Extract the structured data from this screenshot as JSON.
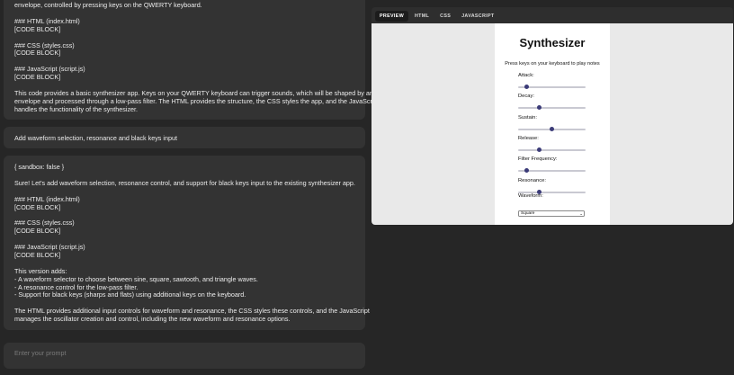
{
  "chat": {
    "msg1_lines": [
      "envelope, controlled by pressing keys on the QWERTY keyboard.",
      "",
      "### HTML (index.html)",
      "[CODE BLOCK]",
      "",
      "### CSS (styles.css)",
      "[CODE BLOCK]",
      "",
      "### JavaScript (script.js)",
      "[CODE BLOCK]",
      "",
      "This code provides a basic synthesizer app. Keys on your QWERTY keyboard can trigger sounds, which will be shaped by an ADSR",
      "envelope and processed through a low-pass filter. The HTML provides the structure, the CSS styles the app, and the JavaScript",
      "handles the functionality of the synthesizer."
    ],
    "user_msg": "Add waveform selection, resonance and black keys input",
    "msg2_lines": [
      "{ sandbox: false }",
      "",
      "Sure! Let's add waveform selection, resonance control, and support for black keys input to the existing synthesizer app.",
      "",
      "### HTML (index.html)",
      "[CODE BLOCK]",
      "",
      "### CSS (styles.css)",
      "[CODE BLOCK]",
      "",
      "### JavaScript (script.js)",
      "[CODE BLOCK]",
      "",
      "This version adds:",
      "- A waveform selector to choose between sine, square, sawtooth, and triangle waves.",
      "- A resonance control for the low-pass filter.",
      "- Support for black keys (sharps and flats) using additional keys on the keyboard.",
      "",
      "The HTML provides additional input controls for waveform and resonance, the CSS styles these controls, and the JavaScript",
      "manages the oscillator creation and control, including the new waveform and resonance options."
    ],
    "prompt_placeholder": "Enter your prompt"
  },
  "preview": {
    "tabs": [
      "PREVIEW",
      "HTML",
      "CSS",
      "JAVASCRIPT"
    ],
    "active_tab": "PREVIEW",
    "app": {
      "title": "Synthesizer",
      "subtitle": "Press keys on your keyboard to play notes",
      "controls": [
        {
          "label": "Attack:",
          "value": 0.1
        },
        {
          "label": "Decay:",
          "value": 0.3
        },
        {
          "label": "Sustain:",
          "value": 0.5
        },
        {
          "label": "Release:",
          "value": 0.3
        },
        {
          "label": "Filter Frequency:",
          "value": 0.1
        },
        {
          "label": "Resonance:",
          "value": 0.3
        }
      ],
      "waveform_label": "Waveform:",
      "waveform_value": "Square",
      "colors": {
        "slider_thumb": "#3b3b78",
        "slider_track": "#c9c9d2"
      }
    }
  }
}
